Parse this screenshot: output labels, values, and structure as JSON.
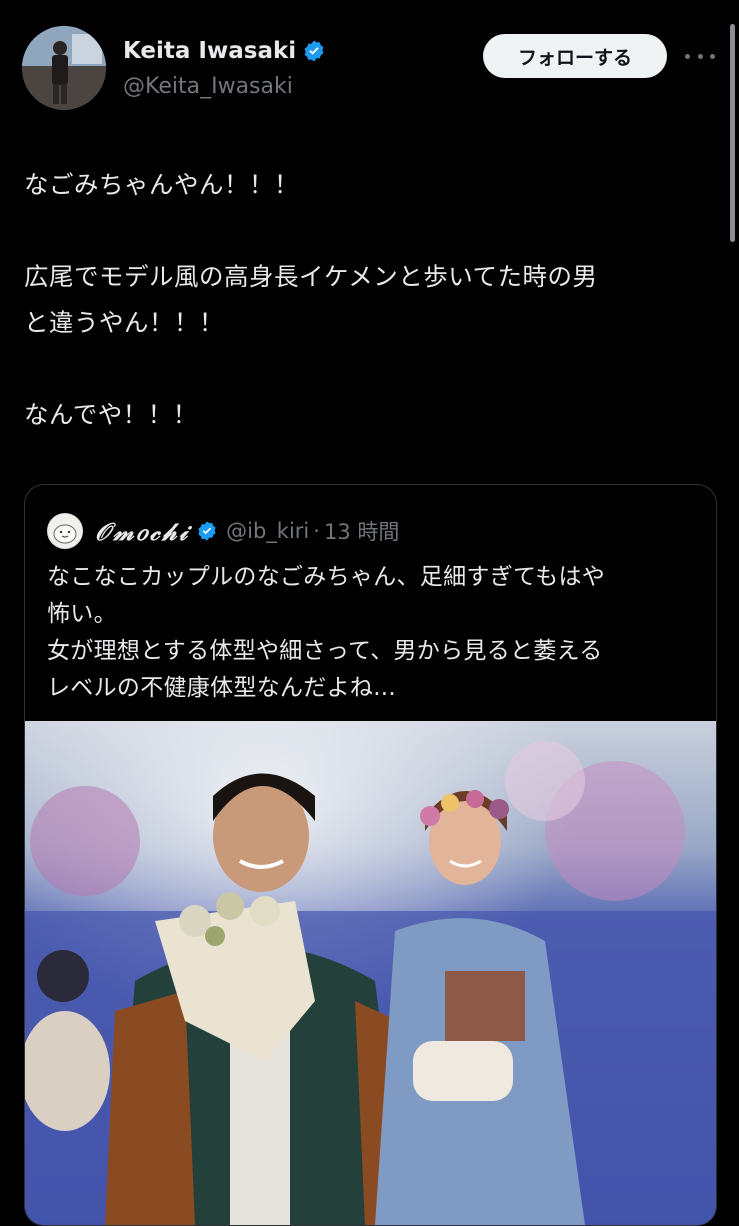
{
  "author": {
    "display_name": "Keita Iwasaki",
    "handle": "@Keita_Iwasaki",
    "verified": true
  },
  "follow_button": "フォローする",
  "tweet_lines": [
    "なごみちゃんやん！！！",
    "",
    "広尾でモデル風の高身長イケメンと歩いてた時の男",
    "と違うやん！！！",
    "",
    "なんでや！！！"
  ],
  "quoted": {
    "display_name": "𝒪𝓂𝑜𝒸𝒽𝒾",
    "handle": "@ib_kiri",
    "separator": "·",
    "time": "13 時間",
    "verified": true,
    "text_lines": [
      "なこなこカップルのなごみちゃん、足細すぎてもはや",
      "怖い。",
      "女が理想とする体型や細さって、男から見ると萎える",
      "レベルの不健康体型なんだよね..."
    ]
  },
  "colors": {
    "background": "#000000",
    "text": "#e7e9ea",
    "muted": "#71767b",
    "verified": "#1d9bf0",
    "button_bg": "#eff3f4"
  }
}
